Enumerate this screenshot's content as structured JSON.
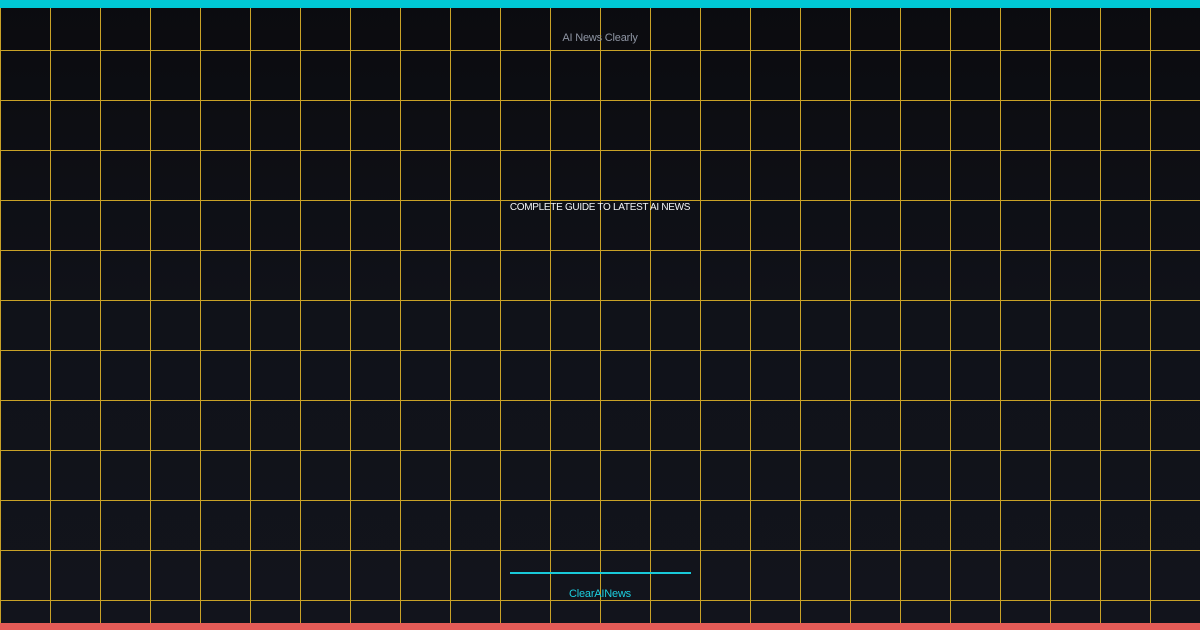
{
  "card": {
    "site_name": "AI News Clearly",
    "headline": "COMPLETE GUIDE TO LATEST AI NEWS",
    "brand": "ClearAINews"
  },
  "colors": {
    "background": "#0f1016",
    "grid_lines": "#c9a227",
    "top_bar": "#00c8d4",
    "bottom_bar": "#e35b57",
    "accent": "#1ccfdf",
    "headline_text": "#f2f4f7",
    "muted_text": "#8f95a3"
  }
}
